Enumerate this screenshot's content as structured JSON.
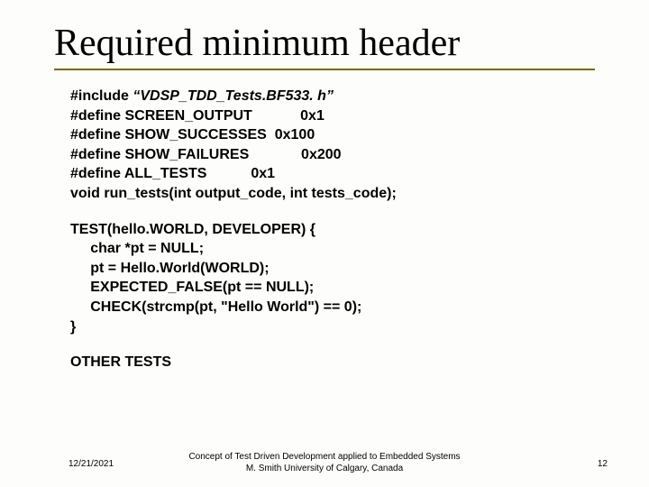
{
  "title": "Required minimum header",
  "code1_line1_prefix": "#include ",
  "code1_line1_italic": "“VDSP_TDD_Tests.BF533. h”",
  "code1_rest": "#define SCREEN_OUTPUT            0x1\n#define SHOW_SUCCESSES  0x100\n#define SHOW_FAILURES             0x200\n#define ALL_TESTS           0x1\nvoid run_tests(int output_code, int tests_code);",
  "code2": "TEST(hello.WORLD, DEVELOPER) {\n     char *pt = NULL;\n     pt = Hello.World(WORLD);\n     EXPECTED_FALSE(pt == NULL);\n     CHECK(strcmp(pt, \"Hello World\") == 0);\n}",
  "code3": "OTHER TESTS",
  "footer": {
    "date": "12/21/2021",
    "center_line1": "Concept of Test Driven Development applied to Embedded Systems",
    "center_line2": "M. Smith University of Calgary, Canada",
    "page": "12"
  }
}
